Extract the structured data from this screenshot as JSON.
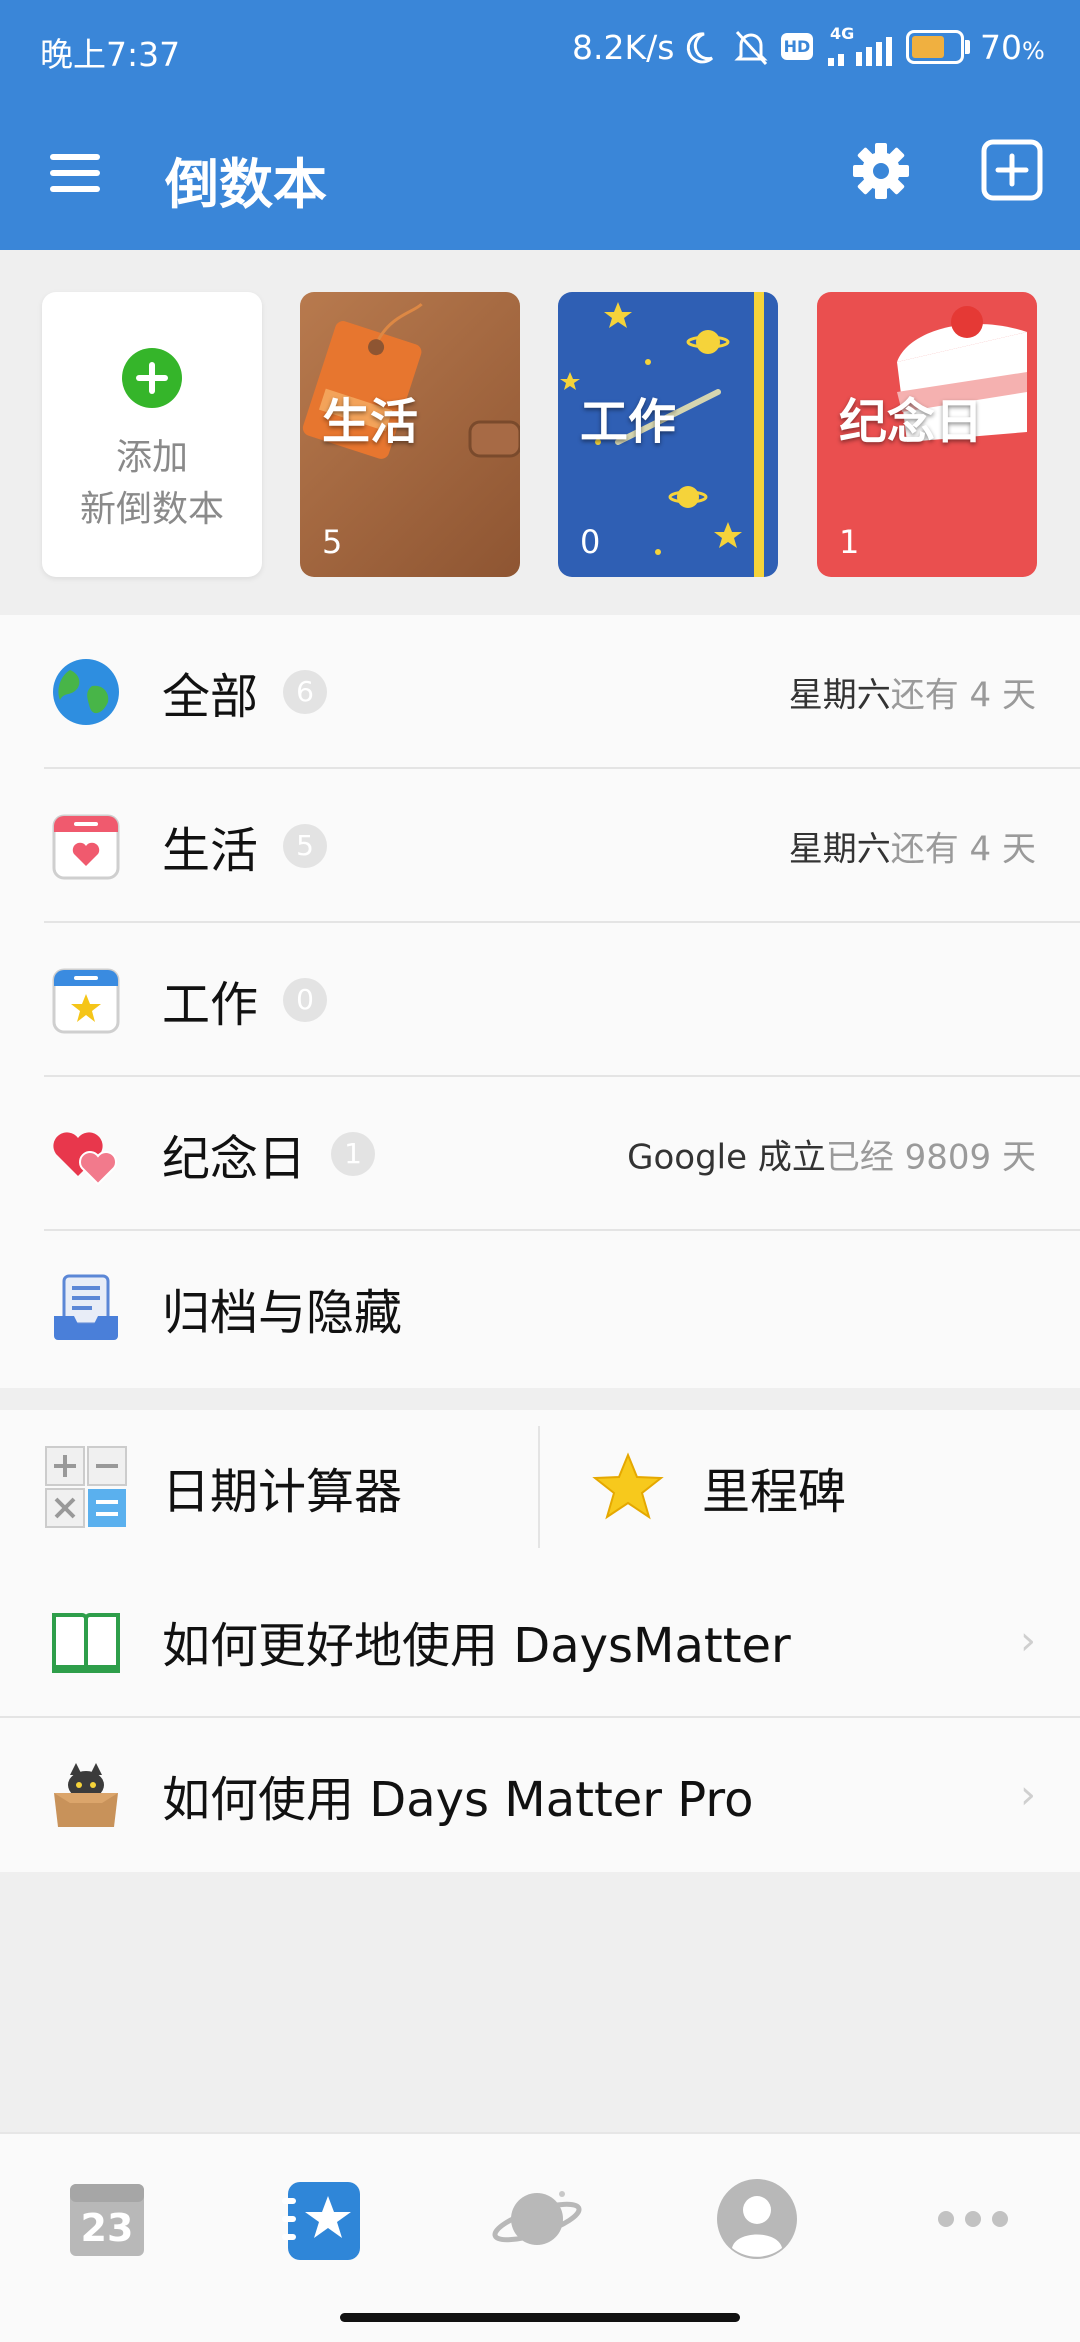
{
  "status_bar": {
    "time": "晚上7:37",
    "network_speed": "8.2K/s",
    "network_type": "4G",
    "hd_label": "HD",
    "battery_percent": "70",
    "battery_percent_suffix": "%",
    "battery_level": 0.7
  },
  "app_bar": {
    "title": "倒数本",
    "icons": [
      "menu-icon",
      "gear-icon",
      "add-box-icon"
    ]
  },
  "notebooks": {
    "add_label_line1": "添加",
    "add_label_line2": "新倒数本",
    "items": [
      {
        "title": "生活",
        "count": "5",
        "color": "#a8693f"
      },
      {
        "title": "工作",
        "count": "0",
        "color": "#2f5fb4"
      },
      {
        "title": "纪念日",
        "count": "1",
        "color": "#ea4f4f"
      }
    ]
  },
  "categories": [
    {
      "label": "全部",
      "badge": "6",
      "note_main": "星期六",
      "note_muted": "还有 4 天",
      "icon": "globe-icon"
    },
    {
      "label": "生活",
      "badge": "5",
      "note_main": "星期六",
      "note_muted": "还有 4 天",
      "icon": "calendar-heart-icon"
    },
    {
      "label": "工作",
      "badge": "0",
      "note_main": "",
      "note_muted": "",
      "icon": "calendar-star-icon"
    },
    {
      "label": "纪念日",
      "badge": "1",
      "note_main": "Google 成立",
      "note_muted": "已经 9809 天",
      "icon": "hearts-icon"
    },
    {
      "label": "归档与隐藏",
      "badge": "",
      "note_main": "",
      "note_muted": "",
      "icon": "archive-icon"
    }
  ],
  "tools": {
    "date_calculator": "日期计算器",
    "milestones": "里程碑"
  },
  "help": [
    {
      "label": "如何更好地使用 DaysMatter",
      "icon": "book-icon"
    },
    {
      "label": "如何使用 Days Matter Pro",
      "icon": "cat-box-icon"
    }
  ],
  "bottom_nav": {
    "calendar_day": "23",
    "items": [
      "calendar-icon",
      "starred-icon",
      "planet-icon",
      "profile-icon",
      "more-icon"
    ]
  },
  "colors": {
    "primary": "#3a86d8",
    "add_green": "#35b52a",
    "selected_nav": "#2f86d8"
  }
}
